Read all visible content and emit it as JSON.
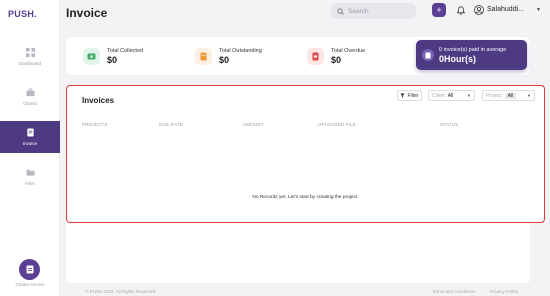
{
  "brand": "PUSH.",
  "nav": {
    "dashboard": "Dashboard",
    "clients": "Clients",
    "invoice": "Invoice",
    "files": "Files",
    "create_invoice": "Create Invoice"
  },
  "header": {
    "title": "Invoice",
    "search_placeholder": "Search",
    "plus_label": "+",
    "user_name": "Salahuddi..."
  },
  "stats": {
    "collected": {
      "label": "Total Collected",
      "value": "$0"
    },
    "outstanding": {
      "label": "Total Outstanding",
      "value": "$0"
    },
    "overdue": {
      "label": "Total Overdue",
      "value": "$0"
    },
    "paid": {
      "label": "0 invoice(s) paid in average",
      "value": "0Hour(s)"
    }
  },
  "invoices": {
    "title": "Invoices",
    "filter_label": "Filter",
    "client_label": "Client",
    "client_value": "All",
    "project_label": "Project",
    "project_value": "All",
    "columns": [
      "PROJECTS",
      "DUE DATE",
      "AMOUNT",
      "UPLOADED FILE",
      "STATUS"
    ],
    "empty_message": "No Records yet. Let's start by creating the project."
  },
  "footer": {
    "copyright": "© PUSH 2022. All Rights Reserved.",
    "terms": "Terms and Conditions",
    "privacy": "Privacy Policy"
  },
  "colors": {
    "primary": "#5a3f95",
    "active_nav": "#4e3a82",
    "collected_icon_bg": "#e3f5ea",
    "outstanding_icon_bg": "#fdf0e2",
    "overdue_icon_bg": "#fde6e6",
    "highlight_border": "#e03a3a"
  }
}
